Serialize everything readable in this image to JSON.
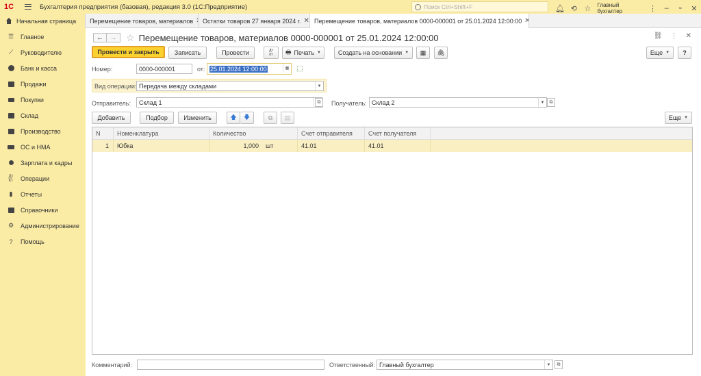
{
  "app": {
    "logo": "1С",
    "title": "Бухгалтерия предприятия (базовая), редакция 3.0  (1С:Предприятие)",
    "search_placeholder": "Поиск Ctrl+Shift+F",
    "user": "Главный бухгалтер"
  },
  "tabs": [
    {
      "label": "Начальная страница"
    },
    {
      "label": "Перемещение товаров, материалов"
    },
    {
      "label": "Остатки товаров 27 января 2024 г."
    },
    {
      "label": "Перемещение товаров, материалов 0000-000001 от 25.01.2024 12:00:00"
    }
  ],
  "sidebar": {
    "items": [
      {
        "label": "Главное",
        "icon": "menu-icon"
      },
      {
        "label": "Руководителю",
        "icon": "chart-line-icon"
      },
      {
        "label": "Банк и касса",
        "icon": "coins-icon"
      },
      {
        "label": "Продажи",
        "icon": "bag-icon"
      },
      {
        "label": "Покупки",
        "icon": "cart-icon"
      },
      {
        "label": "Склад",
        "icon": "warehouse-icon"
      },
      {
        "label": "Производство",
        "icon": "factory-icon"
      },
      {
        "label": "ОС и НМА",
        "icon": "truck-icon"
      },
      {
        "label": "Зарплата и кадры",
        "icon": "person-icon"
      },
      {
        "label": "Операции",
        "icon": "dt-kt-icon"
      },
      {
        "label": "Отчеты",
        "icon": "bar-chart-icon"
      },
      {
        "label": "Справочники",
        "icon": "books-icon"
      },
      {
        "label": "Администрирование",
        "icon": "gear-icon"
      },
      {
        "label": "Помощь",
        "icon": "question-icon"
      }
    ]
  },
  "document": {
    "title": "Перемещение товаров, материалов 0000-000001 от 25.01.2024 12:00:00",
    "toolbar": {
      "post_close": "Провести и закрыть",
      "save": "Записать",
      "post": "Провести",
      "dtkt": "Дт\nКт",
      "print": "Печать",
      "create_based": "Создать на основании",
      "more": "Еще",
      "help": "?"
    },
    "number_label": "Номер:",
    "number": "0000-000001",
    "date_label": "от:",
    "date": "25.01.2024 12:00:00",
    "optype_label": "Вид операции:",
    "optype": "Передача между складами",
    "sender_label": "Отправитель:",
    "sender": "Склад 1",
    "receiver_label": "Получатель:",
    "receiver": "Склад 2",
    "table_toolbar": {
      "add": "Добавить",
      "pick": "Подбор",
      "change": "Изменить",
      "more": "Еще"
    },
    "table": {
      "columns": [
        "N",
        "Номенклатура",
        "Количество",
        "Счет отправителя",
        "Счет получателя"
      ],
      "rows": [
        {
          "n": "1",
          "item": "Юбка",
          "qty": "1,000",
          "unit": "шт",
          "acc_from": "41.01",
          "acc_to": "41.01"
        }
      ]
    },
    "comment_label": "Комментарий:",
    "comment": "",
    "responsible_label": "Ответственный:",
    "responsible": "Главный бухгалтер"
  }
}
